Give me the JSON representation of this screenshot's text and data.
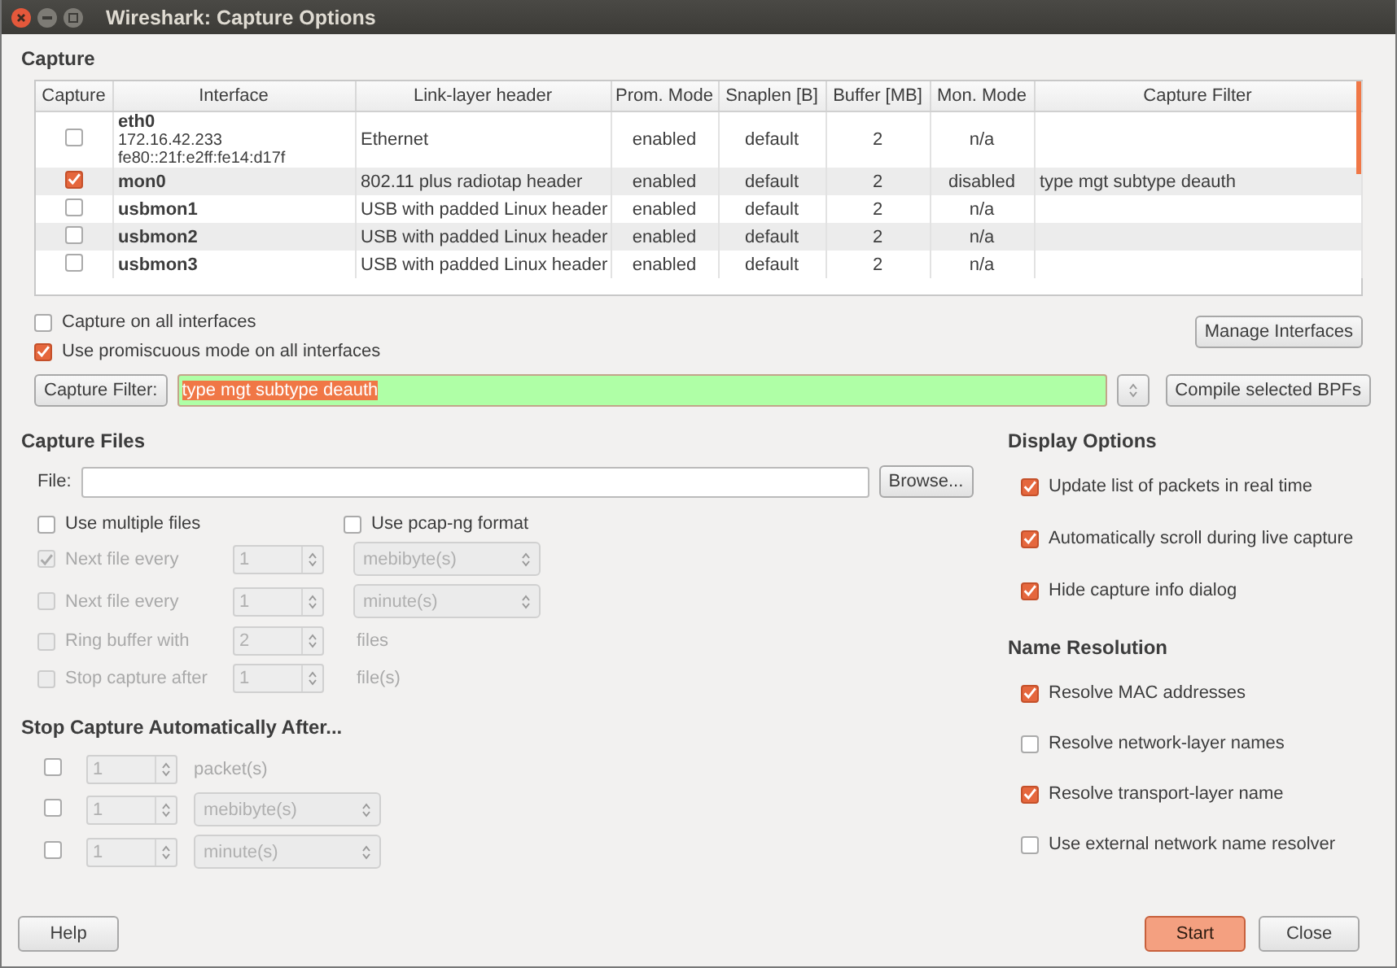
{
  "window": {
    "title": "Wireshark: Capture Options"
  },
  "capture": {
    "heading": "Capture",
    "table": {
      "columns": [
        "Capture",
        "Interface",
        "Link-layer header",
        "Prom. Mode",
        "Snaplen [B]",
        "Buffer [MB]",
        "Mon. Mode",
        "Capture Filter"
      ],
      "rows": [
        {
          "checked": false,
          "interface": "eth0",
          "addresses": [
            "172.16.42.233",
            "fe80::21f:e2ff:fe14:d17f"
          ],
          "link_layer": "Ethernet",
          "prom_mode": "enabled",
          "snaplen": "default",
          "buffer": "2",
          "mon_mode": "n/a"
        },
        {
          "checked": true,
          "interface": "mon0",
          "link_layer": "802.11 plus radiotap header",
          "prom_mode": "enabled",
          "snaplen": "default",
          "buffer": "2",
          "mon_mode": "disabled",
          "capture_filter": "type mgt subtype deauth"
        },
        {
          "checked": false,
          "interface": "usbmon1",
          "link_layer": "USB with padded Linux header",
          "prom_mode": "enabled",
          "snaplen": "default",
          "buffer": "2",
          "mon_mode": "n/a"
        },
        {
          "checked": false,
          "interface": "usbmon2",
          "link_layer": "USB with padded Linux header",
          "prom_mode": "enabled",
          "snaplen": "default",
          "buffer": "2",
          "mon_mode": "n/a"
        },
        {
          "checked": false,
          "interface": "usbmon3",
          "link_layer": "USB with padded Linux header",
          "prom_mode": "enabled",
          "snaplen": "default",
          "buffer": "2",
          "mon_mode": "n/a"
        }
      ]
    },
    "options": [
      {
        "label": "Capture on all interfaces",
        "checked": false
      },
      {
        "label": "Use promiscuous mode on all interfaces",
        "checked": true
      }
    ],
    "manage_button": "Manage Interfaces",
    "filter": {
      "button": "Capture Filter:",
      "value": "type mgt subtype deauth",
      "compile_button": "Compile selected BPFs"
    }
  },
  "capture_files": {
    "heading": "Capture Files",
    "file_label": "File:",
    "browse_button": "Browse...",
    "toggles": [
      {
        "label": "Use multiple files",
        "checked": false
      },
      {
        "label": "Use pcap-ng format",
        "checked": false
      }
    ],
    "rows": [
      {
        "label": "Next file every",
        "checked": true,
        "disabled": true,
        "value": "1",
        "kind": "dropdown",
        "unit": "mebibyte(s)"
      },
      {
        "label": "Next file every",
        "checked": false,
        "disabled": true,
        "value": "1",
        "kind": "dropdown",
        "unit": "minute(s)"
      },
      {
        "label": "Ring buffer with",
        "checked": false,
        "disabled": true,
        "value": "2",
        "kind": "text",
        "unit": "files"
      },
      {
        "label": "Stop capture after",
        "checked": false,
        "disabled": true,
        "value": "1",
        "kind": "text",
        "unit": "file(s)"
      }
    ]
  },
  "stop_capture": {
    "heading": "Stop Capture Automatically After...",
    "rows": [
      {
        "checked": false,
        "value": "1",
        "kind": "text",
        "unit": "packet(s)"
      },
      {
        "checked": false,
        "value": "1",
        "kind": "dropdown",
        "unit": "mebibyte(s)"
      },
      {
        "checked": false,
        "value": "1",
        "kind": "dropdown",
        "unit": "minute(s)"
      }
    ]
  },
  "display_options": {
    "heading": "Display Options",
    "items": [
      {
        "label": "Update list of packets in real time",
        "checked": true
      },
      {
        "label": "Automatically scroll during live capture",
        "checked": true
      },
      {
        "label": "Hide capture info dialog",
        "checked": true
      }
    ]
  },
  "name_resolution": {
    "heading": "Name Resolution",
    "items": [
      {
        "label": "Resolve MAC addresses",
        "checked": true
      },
      {
        "label": "Resolve network-layer names",
        "checked": false
      },
      {
        "label": "Resolve transport-layer name",
        "checked": true
      },
      {
        "label": "Use external network name resolver",
        "checked": false
      }
    ]
  },
  "buttons": {
    "help": "Help",
    "start": "Start",
    "close": "Close"
  }
}
